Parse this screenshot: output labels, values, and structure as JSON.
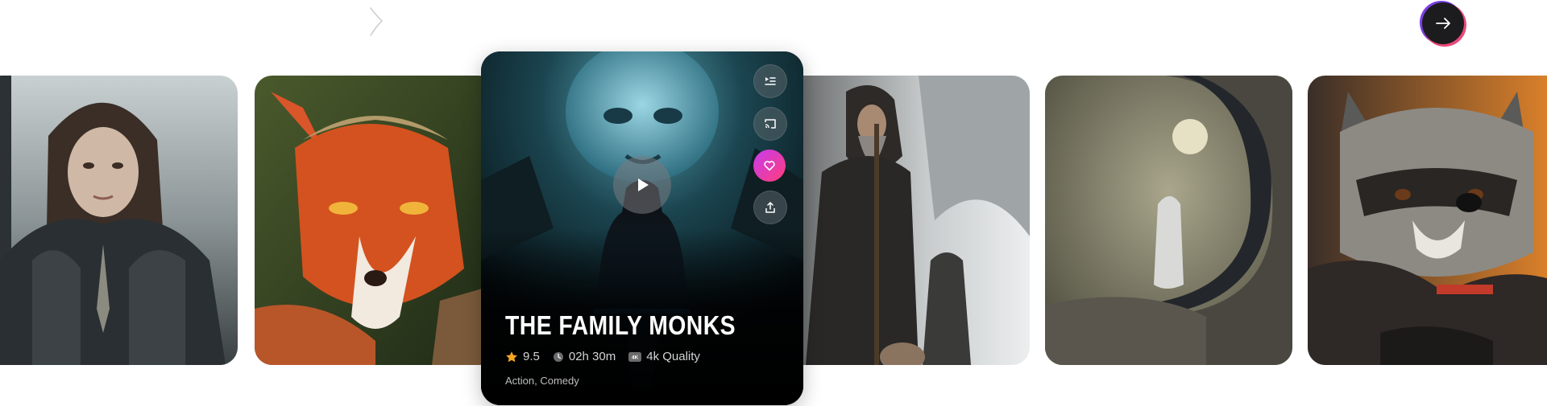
{
  "nav": {
    "prev_icon": "chevron-left-thin-icon",
    "next_icon": "arrow-right-icon"
  },
  "featured": {
    "title": "THE FAMILY MONKS",
    "rating": "9.5",
    "duration": "02h 30m",
    "quality": "4k Quality",
    "quality_badge": "4K",
    "genres": "Action, Comedy",
    "actions": [
      "add-to-list-icon",
      "cast-icon",
      "heart-icon",
      "share-icon"
    ]
  },
  "cards": [
    {
      "name": "armored-woman",
      "subject": "woman in dark armor in the rain"
    },
    {
      "name": "fox-warrior",
      "subject": "fox-faced warrior"
    },
    {
      "name": "bearded-monks",
      "subject": "bearded old man with staff and hooded figure on mountain"
    },
    {
      "name": "ghost-under-moon",
      "subject": "shrouded figure under moon in rock arch"
    },
    {
      "name": "raccoon",
      "subject": "raccoon in leather jacket"
    }
  ],
  "colors": {
    "accent_gradient_start": "#c63cf0",
    "accent_gradient_end": "#ff3d7a",
    "star": "#f5a623",
    "next_button_bg": "#1c1c1e"
  }
}
